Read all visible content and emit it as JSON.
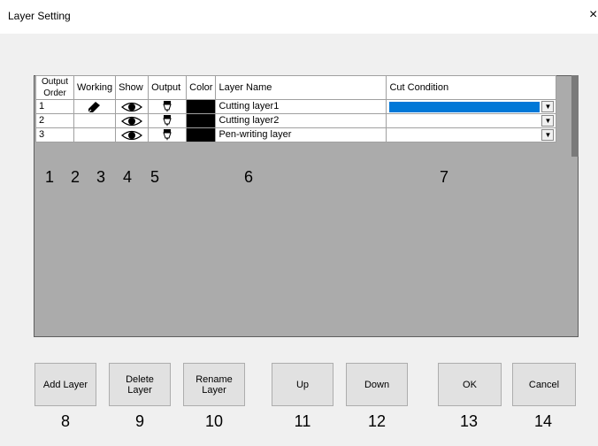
{
  "window": {
    "title": "Layer Setting",
    "close_glyph": "×"
  },
  "table": {
    "headers": {
      "order": "Output Order",
      "working": "Working",
      "show": "Show",
      "output": "Output",
      "color": "Color",
      "name": "Layer Name",
      "cut": "Cut Condition"
    },
    "rows": [
      {
        "order": "1",
        "working_icon": "pencil-icon",
        "show_icon": "eye-icon",
        "output_icon": "cutter-icon",
        "color": "#000000",
        "name": "Cutting layer1",
        "cut": "",
        "cut_selected": true
      },
      {
        "order": "2",
        "working_icon": "",
        "show_icon": "eye-icon",
        "output_icon": "cutter-icon",
        "color": "#000000",
        "name": "Cutting layer2",
        "cut": "",
        "cut_selected": false
      },
      {
        "order": "3",
        "working_icon": "",
        "show_icon": "eye-icon",
        "output_icon": "cutter-icon",
        "color": "#000000",
        "name": "Pen-writing layer",
        "cut": "",
        "cut_selected": false
      }
    ],
    "selection_color": "#0078d7"
  },
  "column_numbers": [
    "1",
    "2",
    "3",
    "4",
    "5",
    "6",
    "7"
  ],
  "buttons": [
    {
      "label": "Add Layer",
      "number": "8"
    },
    {
      "label": "Delete\nLayer",
      "number": "9"
    },
    {
      "label": "Rename\nLayer",
      "number": "10"
    },
    {
      "label": "Up",
      "number": "11"
    },
    {
      "label": "Down",
      "number": "12"
    },
    {
      "label": "OK",
      "number": "13"
    },
    {
      "label": "Cancel",
      "number": "14"
    }
  ]
}
